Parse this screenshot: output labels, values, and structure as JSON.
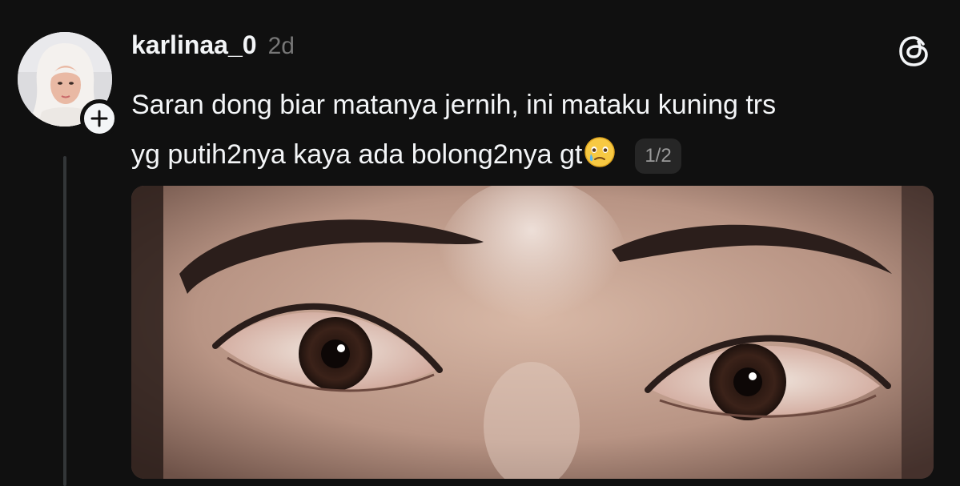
{
  "post": {
    "username": "karlinaa_0",
    "timestamp": "2d",
    "text_line1": "Saran dong biar matanya jernih, ini mataku kuning trs",
    "text_line2": "yg putih2nya kaya ada bolong2nya gt",
    "emoji": "face-holding-back-tears",
    "image_counter": "1/2"
  },
  "icons": {
    "follow": "plus-icon",
    "app_logo": "threads-logo-icon"
  },
  "colors": {
    "background": "#101010",
    "text_primary": "#f3f5f7",
    "text_secondary": "#777777",
    "thread_line": "#333638"
  }
}
